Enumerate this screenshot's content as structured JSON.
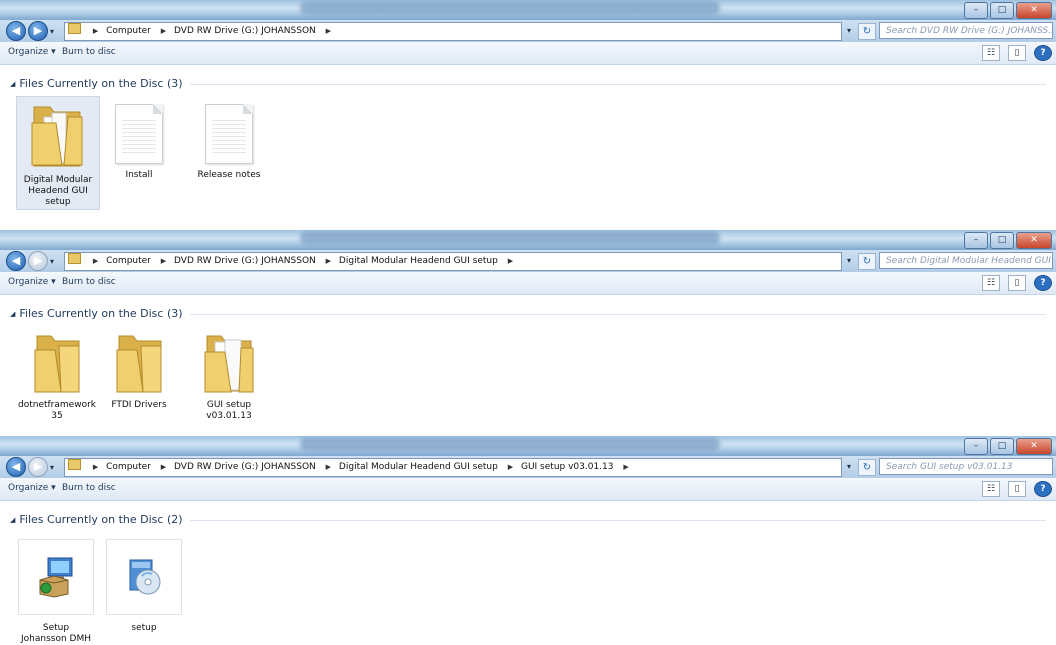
{
  "windows": [
    {
      "crumbs": [
        "Computer",
        "DVD RW Drive (G:) JOHANSSON"
      ],
      "search_placeholder": "Search DVD RW Drive (G:) JOHANSS...",
      "organize_label": "Organize ▾",
      "burn_label": "Burn to disc",
      "group_label": "Files Currently on the Disc (3)",
      "items": [
        {
          "label": "Digital Modular Headend GUI setup",
          "type": "folder-open"
        },
        {
          "label": "Install",
          "type": "document"
        },
        {
          "label": "Release notes",
          "type": "document"
        }
      ]
    },
    {
      "crumbs": [
        "Computer",
        "DVD RW Drive (G:) JOHANSSON",
        "Digital Modular Headend GUI setup"
      ],
      "search_placeholder": "Search Digital Modular Headend GUI ...",
      "organize_label": "Organize ▾",
      "burn_label": "Burn to disc",
      "group_label": "Files Currently on the Disc (3)",
      "items": [
        {
          "label": "dotnetframework 35",
          "type": "folder"
        },
        {
          "label": "FTDI Drivers",
          "type": "folder"
        },
        {
          "label": "GUI setup v03.01.13",
          "type": "folder-open"
        }
      ]
    },
    {
      "crumbs": [
        "Computer",
        "DVD RW Drive (G:) JOHANSSON",
        "Digital Modular Headend GUI setup",
        "GUI setup v03.01.13"
      ],
      "search_placeholder": "Search GUI setup v03.01.13",
      "organize_label": "Organize ▾",
      "burn_label": "Burn to disc",
      "group_label": "Files Currently on the Disc (2)",
      "items": [
        {
          "label": "Setup Johansson DMH",
          "type": "installer"
        },
        {
          "label": "setup",
          "type": "setup-exe"
        }
      ]
    }
  ],
  "icons": {
    "back": "back-arrow-icon",
    "forward": "forward-arrow-icon",
    "refresh": "refresh-icon",
    "search": "search-icon",
    "help": "help-icon"
  },
  "colors": {
    "title_gradient": "#9fc2e0",
    "address_bg": "#cfe1f2",
    "folder": "#e9c86a",
    "close_button": "#c8452b"
  }
}
